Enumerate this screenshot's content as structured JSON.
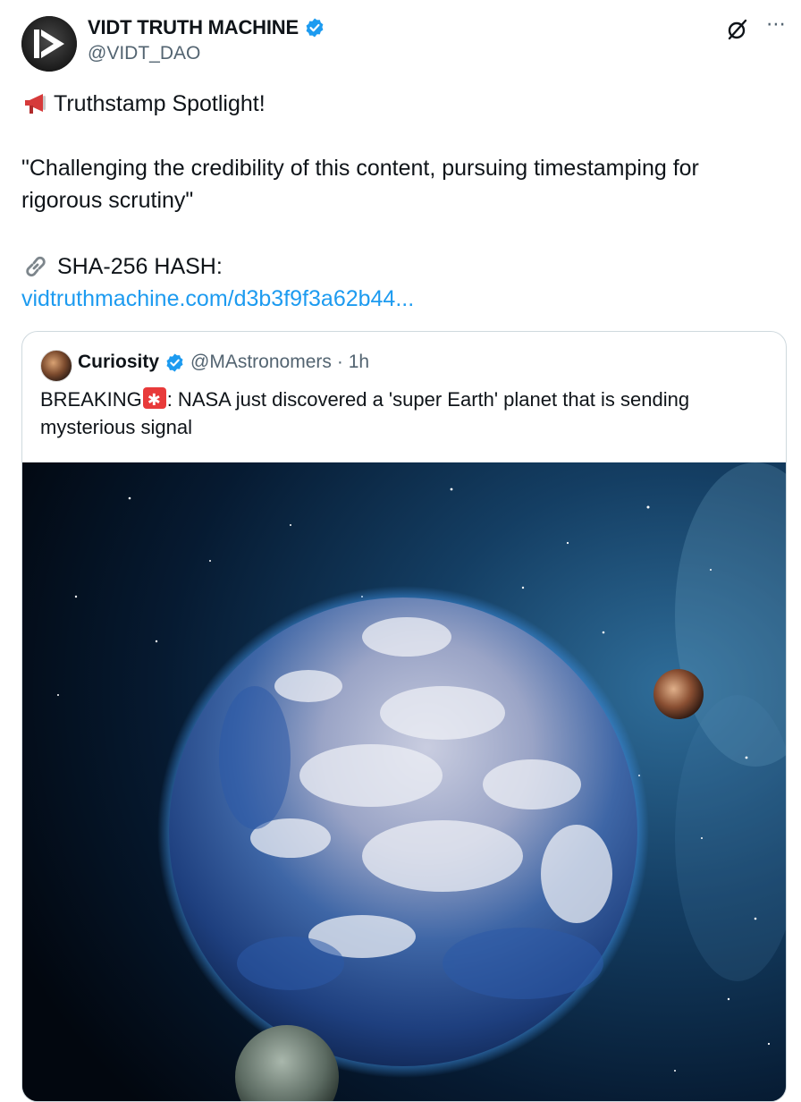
{
  "author": {
    "name": "VIDT TRUTH MACHINE",
    "handle": "@VIDT_DAO",
    "verified": true,
    "avatar_icon": "vidt-logo-icon"
  },
  "post": {
    "line1": "Truthstamp Spotlight!",
    "line1_icon": "megaphone-icon",
    "line2": "\"Challenging the credibility of this content, pursuing timestamping for rigorous scrutiny\"",
    "line3": "SHA-256 HASH:",
    "line3_icon": "link-icon",
    "link": "vidtruthmachine.com/d3b3f9f3a62b44..."
  },
  "quote": {
    "name": "Curiosity",
    "handle": "@MAstronomers",
    "time": "· 1h",
    "verified": true,
    "text_prefix": "BREAKING",
    "text_suffix": ": NASA just discovered a 'super Earth' planet that is sending mysterious signal",
    "emoji_icon": "siren-icon",
    "media": "space-planet-image"
  },
  "colors": {
    "link": "#1d9bf0",
    "verified": "#1d9bf0",
    "secondary_text": "#536471",
    "border": "#cfd9de"
  }
}
